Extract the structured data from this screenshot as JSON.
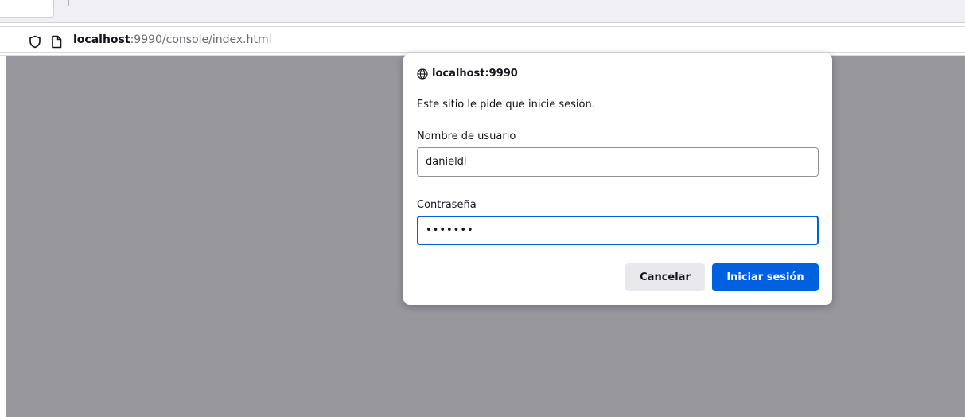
{
  "browser": {
    "url_host": "localhost",
    "url_rest": ":9990/console/index.html",
    "icons": {
      "tracking": "shield-icon",
      "page": "page-icon"
    }
  },
  "dialog": {
    "origin": "localhost:9990",
    "message": "Este sitio le pide que inicie sesión.",
    "username_label": "Nombre de usuario",
    "username_value": "danieldl",
    "password_label": "Contraseña",
    "password_value": "•••••••",
    "cancel_label": "Cancelar",
    "login_label": "Iniciar sesión",
    "icon": "globe-icon"
  },
  "colors": {
    "accent": "#0061e0",
    "overlay": "#97979c",
    "secondary_button": "#e9e9ed"
  }
}
